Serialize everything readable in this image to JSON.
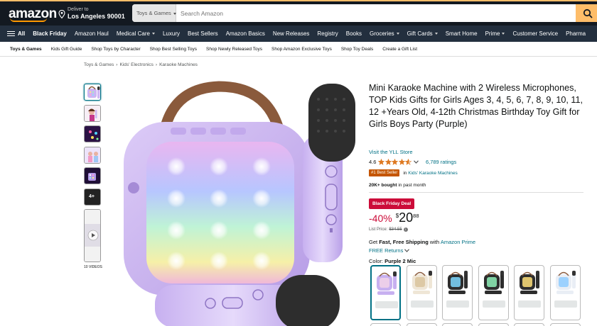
{
  "header": {
    "logo": "amazon",
    "deliver_line1": "Deliver to",
    "deliver_line2": "Los Angeles 90001",
    "search_category": "Toys & Games",
    "search_placeholder": "Search Amazon"
  },
  "nav": {
    "all_label": "All",
    "items": [
      {
        "label": "Black Friday",
        "bold": true
      },
      {
        "label": "Amazon Haul"
      },
      {
        "label": "Medical Care",
        "dropdown": true
      },
      {
        "label": "Luxury"
      },
      {
        "label": "Best Sellers"
      },
      {
        "label": "Amazon Basics"
      },
      {
        "label": "New Releases"
      },
      {
        "label": "Registry"
      },
      {
        "label": "Books"
      },
      {
        "label": "Groceries",
        "dropdown": true
      },
      {
        "label": "Gift Cards",
        "dropdown": true
      },
      {
        "label": "Smart Home"
      },
      {
        "label": "Prime",
        "dropdown": true
      },
      {
        "label": "Customer Service"
      },
      {
        "label": "Pharma"
      }
    ]
  },
  "subnav": {
    "items": [
      "Toys & Games",
      "Kids Gift Guide",
      "Shop Toys by Character",
      "Shop Best Selling Toys",
      "Shop Newly Released Toys",
      "Shop Amazon Exclusive Toys",
      "Shop Toy Deals",
      "Create a Gift List"
    ]
  },
  "breadcrumb": [
    "Toys & Games",
    "Kids' Electronics",
    "Karaoke Machines"
  ],
  "breadcrumb_separator": "›",
  "thumbnails": {
    "video_label": "10 VIDEOS",
    "more_label": "4+"
  },
  "product": {
    "title": "Mini Karaoke Machine with 2 Wireless Microphones, TOP Kids Gifts for Girls Ages 3, 4, 5, 6, 7, 8, 9, 10, 11, 12 +Years Old, 4-12th Christmas Birthday Toy Gift for Girls Boys Party (Purple)",
    "store": "Visit the YLL Store",
    "rating": "4.6",
    "rating_value": 4.6,
    "rating_count": "6,789 ratings",
    "best_seller_badge": "#1 Best Seller",
    "best_seller_in": "in",
    "best_seller_category": "Kids' Karaoke Machines",
    "bought_bold": "20K+ bought",
    "bought_rest": "in past month",
    "deal_badge": "Black Friday Deal",
    "discount": "-40%",
    "price_currency": "$",
    "price_whole": "20",
    "price_fraction": "88",
    "list_price_label": "List Price:",
    "list_price": "$34.55",
    "info_symbol": "i",
    "shipping_get": "Get",
    "shipping_bold": "Fast, Free Shipping",
    "shipping_with": "with",
    "shipping_prime": "Amazon Prime",
    "returns": "FREE Returns",
    "color_label": "Color:",
    "color_value": "Purple 2 Mic"
  },
  "colors": {
    "header_bg": "#131921",
    "nav_bg": "#232f3e",
    "accent_orange": "#ff9900",
    "search_button": "#febd69",
    "link": "#007185",
    "deal_red": "#cc0c39",
    "best_seller": "#c45500",
    "product_purple": "#c7b0f0"
  },
  "icons": {
    "pin": "location-pin-icon",
    "search": "search-icon",
    "menu": "hamburger-menu-icon",
    "star": "star-icon",
    "chevron": "chevron-down-icon"
  }
}
